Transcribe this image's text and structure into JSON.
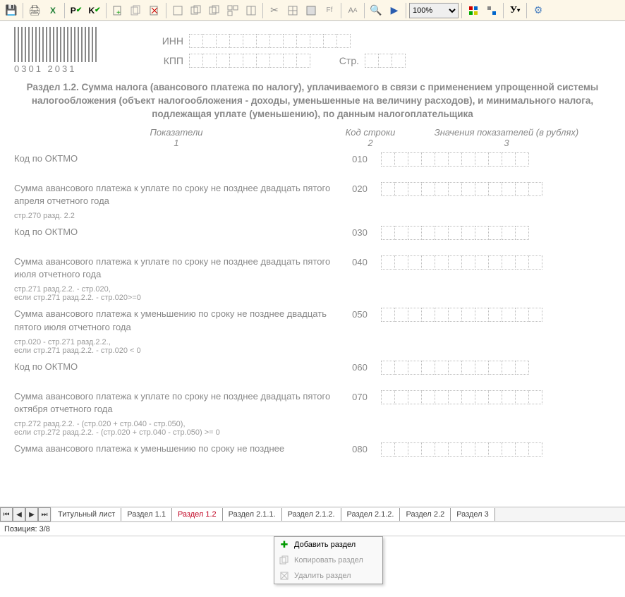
{
  "toolbar": {
    "zoom": "100%"
  },
  "header": {
    "barcode_text": "0301 2031",
    "inn_label": "ИНН",
    "kpp_label": "КПП",
    "str_label": "Стр."
  },
  "section_title": "Раздел 1.2. Сумма налога (авансового платежа по налогу), уплачиваемого в связи с применением упрощенной системы налогообложения (объект налогообложения - доходы, уменьшенные на величину расходов), и минимального налога, подлежащая уплате (уменьшению), по данным налогоплательщика",
  "columns": {
    "c1": "Показатели",
    "c1n": "1",
    "c2": "Код строки",
    "c2n": "2",
    "c3": "Значения показателей (в рублях)",
    "c3n": "3"
  },
  "rows": [
    {
      "label": "Код по ОКТМО",
      "code": "010",
      "note": ""
    },
    {
      "label": "Сумма авансового платежа к уплате по сроку не позднее двадцать пятого апреля отчетного года",
      "code": "020",
      "note": "стр.270 разд. 2.2"
    },
    {
      "label": "Код по ОКТМО",
      "code": "030",
      "note": ""
    },
    {
      "label": "Сумма  авансового платежа к уплате по сроку не позднее двадцать пятого июля отчетного года",
      "code": "040",
      "note": "стр.271 разд.2.2. - стр.020,\nесли стр.271 разд.2.2. - стр.020>=0"
    },
    {
      "label": "Сумма авансового платежа к уменьшению по сроку не позднее двадцать пятого июля отчетного года",
      "code": "050",
      "note": "стр.020 - стр.271 разд.2.2.,\nесли стр.271 разд.2.2. - стр.020 < 0"
    },
    {
      "label": "Код по ОКТМО",
      "code": "060",
      "note": ""
    },
    {
      "label": "Сумма авансового платежа к уплате по сроку не позднее двадцать пятого октября отчетного года",
      "code": "070",
      "note": "стр.272 разд.2.2. - (стр.020 + стр.040 - стр.050),\nесли стр.272 разд.2.2. - (стр.020 + стр.040 - стр.050) >= 0"
    },
    {
      "label": "Сумма авансового платежа к уменьшению по сроку не позднее",
      "code": "080",
      "note": ""
    }
  ],
  "tabs": [
    {
      "label": "Титульный лист",
      "active": false
    },
    {
      "label": "Раздел 1.1",
      "active": false
    },
    {
      "label": "Раздел 1.2",
      "active": true
    },
    {
      "label": "Раздел 2.1.1.",
      "active": false
    },
    {
      "label": "Раздел 2.1.2.",
      "active": false
    },
    {
      "label": "Раздел 2.1.2.",
      "active": false
    },
    {
      "label": "Раздел 2.2",
      "active": false
    },
    {
      "label": "Раздел 3",
      "active": false
    }
  ],
  "status": {
    "position_label": "Позиция:",
    "position_value": "3/8"
  },
  "context_menu": {
    "add": "Добавить раздел",
    "copy": "Копировать раздел",
    "delete": "Удалить раздел"
  }
}
